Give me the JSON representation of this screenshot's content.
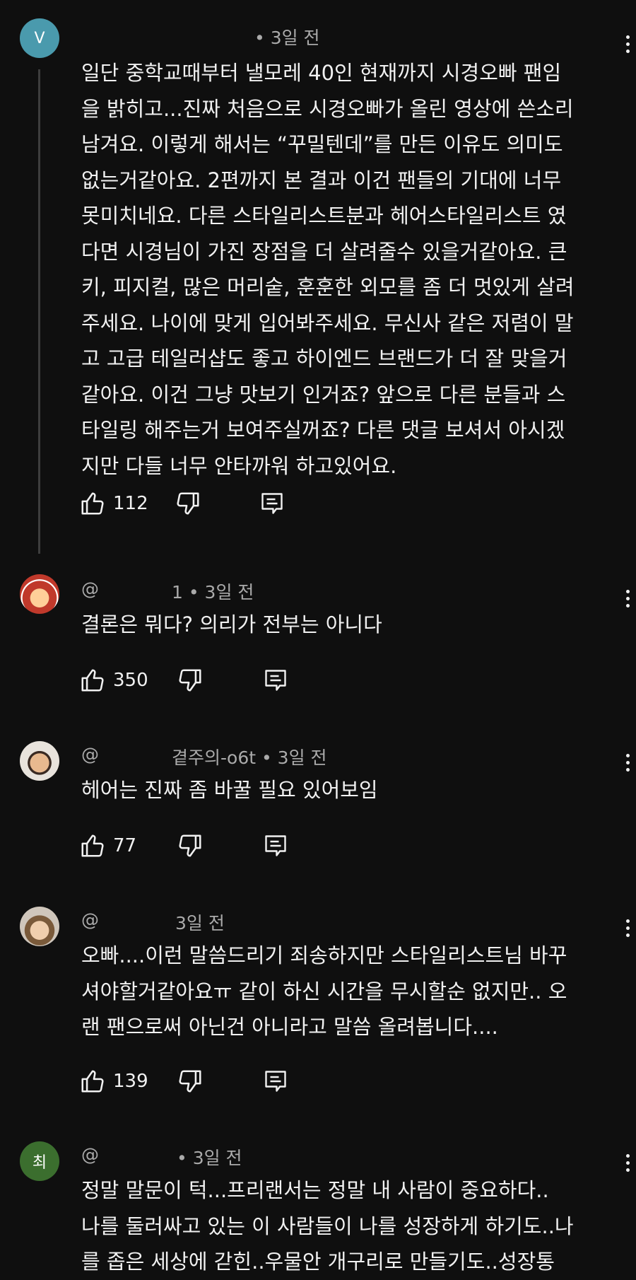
{
  "comments": [
    {
      "avatar_text": "V",
      "avatar_color": "#4a9aad",
      "handle": "",
      "suffix": "• 3일 전",
      "text": "일단 중학교때부터 낼모레 40인 현재까지 시경오빠 팬임\n을 밝히고...진짜 처음으로 시경오빠가 올린 영상에 쓴소리\n남겨요. 이렇게 해서는 “꾸밀텐데”를 만든 이유도 의미도\n없는거같아요. 2편까지 본 결과 이건 팬들의 기대에 너무\n못미치네요. 다른 스타일리스트분과 헤어스타일리스트 였\n다면 시경님이 가진 장점을 더 살려줄수 있을거같아요.  큰\n키, 피지컬, 많은 머리숱, 훈훈한 외모를 좀 더 멋있게 살려\n주세요. 나이에 맞게 입어봐주세요. 무신사 같은 저렴이 말\n고 고급 테일러샵도 좋고 하이엔드 브랜드가 더 잘 맞을거\n같아요.  이건 그냥 맛보기 인거죠? 앞으로 다른 분들과 스\n타일링 해주는거 보여주실꺼죠? 다른 댓글 보셔서 아시겠\n지만 다들 너무 안타까워 하고있어요.",
      "likes": "112"
    },
    {
      "avatar_text": "",
      "avatar_color": "#c0392b",
      "handle": "@",
      "suffix": "1 • 3일 전",
      "text": "결론은 뭐다? 의리가 전부는 아니다",
      "likes": "350"
    },
    {
      "avatar_text": "",
      "avatar_color": "#d9c6b4",
      "handle": "@",
      "suffix": "곁주의-o6t • 3일 전",
      "text": "헤어는 진짜 좀 바꿀 필요 있어보임",
      "likes": "77"
    },
    {
      "avatar_text": "",
      "avatar_color": "#b89c82",
      "handle": "@",
      "suffix": "3일 전",
      "text": "오빠....이런 말씀드리기 죄송하지만 스타일리스트님  바꾸\n셔야할거같아요ㅠ 같이 하신 시간을 무시할순 없지만.. 오\n랜 팬으로써  아닌건  아니라고 말씀 올려봅니다....",
      "likes": "139"
    },
    {
      "avatar_text": "최",
      "avatar_color": "#3b6e2e",
      "handle": "@",
      "suffix": "• 3일 전",
      "text": "정말 말문이 턱...프리랜서는 정말 내 사람이 중요하다..\n나를 둘러싸고 있는 이 사람들이 나를 성장하게 하기도..나\n를 좁은 세상에 갇힌..우물안 개구리로 만들기도..성장통",
      "likes": ""
    }
  ]
}
